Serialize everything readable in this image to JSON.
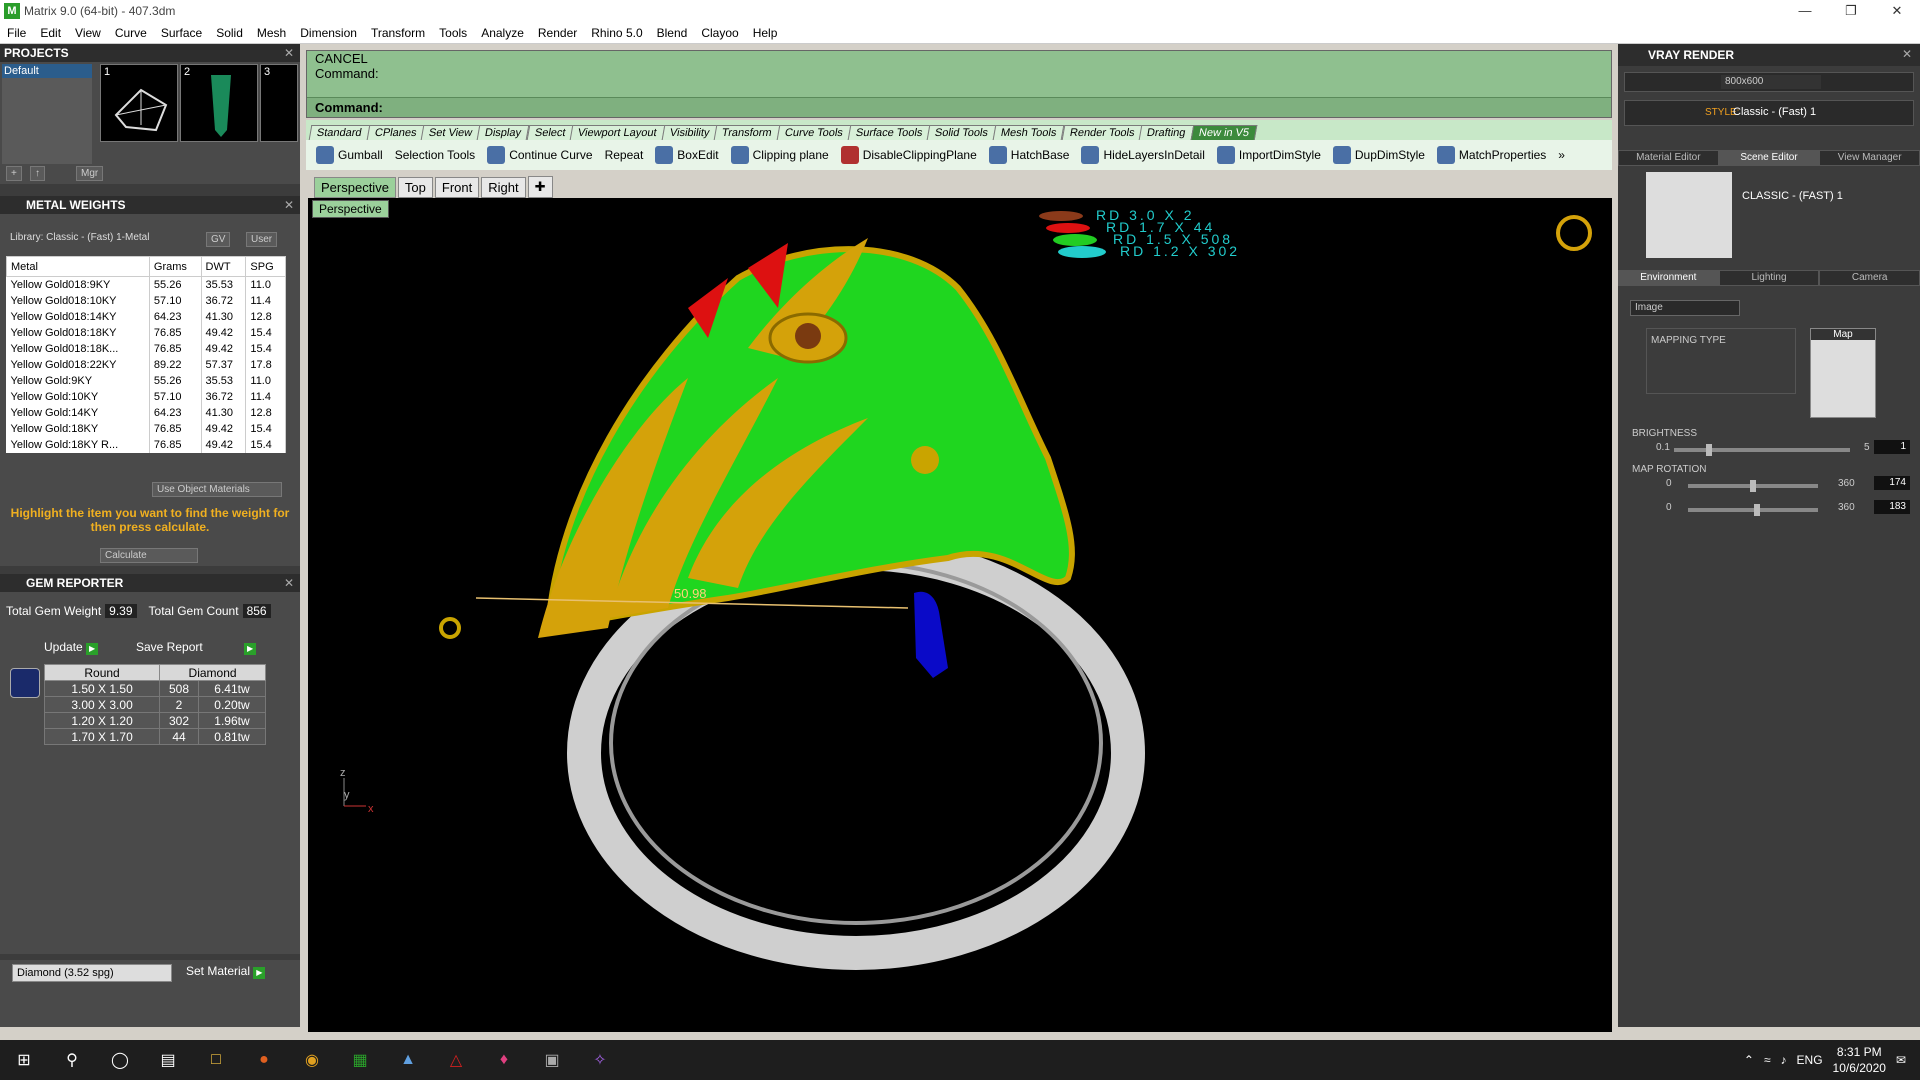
{
  "window": {
    "title": "Matrix 9.0 (64-bit) - 407.3dm",
    "app_icon": "M"
  },
  "menu": [
    "File",
    "Edit",
    "View",
    "Curve",
    "Surface",
    "Solid",
    "Mesh",
    "Dimension",
    "Transform",
    "Tools",
    "Analyze",
    "Render",
    "Rhino 5.0",
    "Blend",
    "Clayoo",
    "Help"
  ],
  "projects": {
    "title": "PROJECTS",
    "default_item": "Default",
    "thumb_nums": [
      "1",
      "2",
      "3"
    ],
    "mgr": "Mgr"
  },
  "metal_weights": {
    "title": "METAL WEIGHTS",
    "library": "Library: Classic - (Fast) 1-Metal",
    "gv": "GV",
    "user": "User",
    "headers": [
      "Metal",
      "Grams",
      "DWT",
      "SPG"
    ],
    "rows": [
      [
        "Yellow Gold018:9KY",
        "55.26",
        "35.53",
        "11.0"
      ],
      [
        "Yellow Gold018:10KY",
        "57.10",
        "36.72",
        "11.4"
      ],
      [
        "Yellow Gold018:14KY",
        "64.23",
        "41.30",
        "12.8"
      ],
      [
        "Yellow Gold018:18KY",
        "76.85",
        "49.42",
        "15.4"
      ],
      [
        "Yellow Gold018:18K...",
        "76.85",
        "49.42",
        "15.4"
      ],
      [
        "Yellow Gold018:22KY",
        "89.22",
        "57.37",
        "17.8"
      ],
      [
        "Yellow Gold:9KY",
        "55.26",
        "35.53",
        "11.0"
      ],
      [
        "Yellow Gold:10KY",
        "57.10",
        "36.72",
        "11.4"
      ],
      [
        "Yellow Gold:14KY",
        "64.23",
        "41.30",
        "12.8"
      ],
      [
        "Yellow Gold:18KY",
        "76.85",
        "49.42",
        "15.4"
      ],
      [
        "Yellow Gold:18KY R...",
        "76.85",
        "49.42",
        "15.4"
      ]
    ],
    "use_object_materials": "Use Object Materials",
    "hint": "Highlight the item you want to find the weight for then press calculate.",
    "calculate": "Calculate"
  },
  "gem_reporter": {
    "title": "GEM REPORTER",
    "total_weight_label": "Total Gem Weight",
    "total_weight": "9.39",
    "total_count_label": "Total Gem Count",
    "total_count": "856",
    "update": "Update",
    "save_report": "Save Report",
    "headers": [
      "Round",
      "Diamond"
    ],
    "rows": [
      [
        "1.50 X 1.50",
        "508",
        "6.41tw"
      ],
      [
        "3.00 X 3.00",
        "2",
        "0.20tw"
      ],
      [
        "1.20 X 1.20",
        "302",
        "1.96tw"
      ],
      [
        "1.70 X 1.70",
        "44",
        "0.81tw"
      ]
    ],
    "material_select": "Diamond    (3.52 spg)",
    "set_material": "Set Material"
  },
  "command": {
    "line1": "CANCEL",
    "line2": "Command:",
    "prompt": "Command:"
  },
  "tool_tabs": [
    "Standard",
    "CPlanes",
    "Set View",
    "Display",
    "Select",
    "Viewport Layout",
    "Visibility",
    "Transform",
    "Curve Tools",
    "Surface Tools",
    "Solid Tools",
    "Mesh Tools",
    "Render Tools",
    "Drafting",
    "New in V5"
  ],
  "toolbar": [
    "Gumball",
    "Selection Tools",
    "Continue Curve",
    "Repeat",
    "BoxEdit",
    "Clipping plane",
    "DisableClippingPlane",
    "HatchBase",
    "HideLayersInDetail",
    "ImportDimStyle",
    "DupDimStyle",
    "MatchProperties"
  ],
  "view_tabs": [
    "Perspective",
    "Top",
    "Front",
    "Right"
  ],
  "viewport": {
    "label": "Perspective",
    "dimension": "50.98",
    "legend": [
      "RD 3.0 X 2",
      "RD 1.7 X 44",
      "RD 1.5 X 508",
      "RD 1.2 X 302"
    ],
    "legend_colors": [
      "#8b3a1a",
      "#dd1111",
      "#22cc22",
      "#22cccc"
    ],
    "axis_z": "z",
    "axis_y": "y",
    "axis_x": "x"
  },
  "vray": {
    "title": "VRAY RENDER",
    "resolution": "800x600",
    "style_label": "STYLE:",
    "style": "Classic - (Fast) 1",
    "tabs": [
      "Material Editor",
      "Scene Editor",
      "View Manager"
    ],
    "scene_name": "CLASSIC - (FAST) 1",
    "env_tabs": [
      "Environment",
      "Lighting",
      "Camera"
    ],
    "image_select": "Image",
    "map_label": "Map",
    "mapping_type": "MAPPING TYPE",
    "brightness_label": "BRIGHTNESS",
    "brightness_min": "0.1",
    "brightness_max": "5",
    "brightness_value": "1",
    "rotation_label": "MAP ROTATION",
    "rot1_min": "0",
    "rot1_max": "360",
    "rot1_value": "174",
    "rot2_min": "0",
    "rot2_max": "360",
    "rot2_value": "183"
  },
  "taskbar": {
    "lang": "ENG",
    "time": "8:31 PM",
    "date": "10/6/2020"
  }
}
